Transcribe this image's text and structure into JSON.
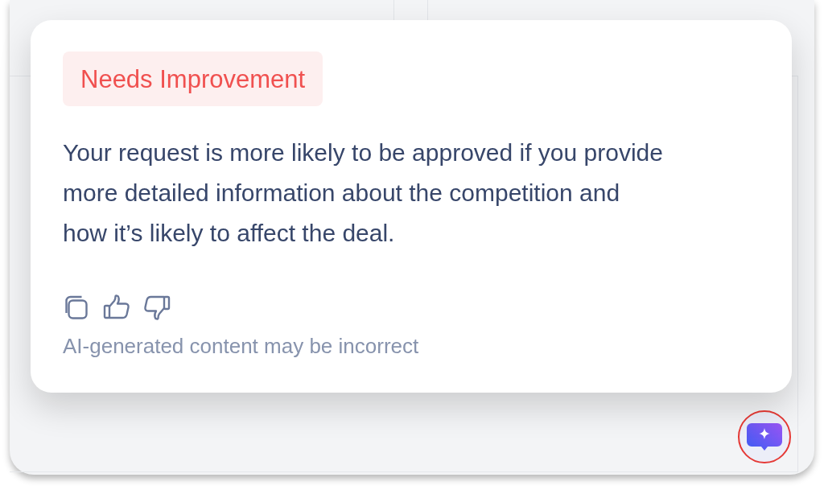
{
  "feedback_card": {
    "rating_badge": {
      "label": "Needs Improvement"
    },
    "message_lines": [
      "Your request is more likely to be approved if you provide",
      "more detailed information about the competition and",
      "how it’s likely to affect the deal."
    ],
    "disclaimer": "AI-generated content may be incorrect"
  }
}
